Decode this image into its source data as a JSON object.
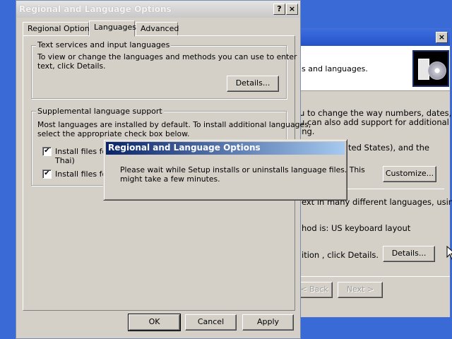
{
  "background_window": {
    "close_glyph": "×",
    "header_text": "s and languages.",
    "body_lines": [
      "u to change the way numbers, dates,",
      "u can also add support for additional",
      "ing."
    ],
    "locale_line": "ted States), and the",
    "customize_label": "Customize...",
    "text_line": "ext in many different languages, using",
    "method_line": "hod is: US keyboard layout",
    "details_line": "ition , click Details.",
    "details_label": "Details...",
    "back_label": "< Back",
    "next_label": "Next >"
  },
  "dialog": {
    "title": "Regional and Language Options",
    "help_glyph": "?",
    "close_glyph": "×",
    "tabs": [
      {
        "label": "Regional Options"
      },
      {
        "label": "Languages"
      },
      {
        "label": "Advanced"
      }
    ],
    "text_services": {
      "legend": "Text services and input languages",
      "line1": "To view or change the languages and methods you can use to enter",
      "line2": "text, click Details.",
      "details_label": "Details..."
    },
    "supplemental": {
      "legend": "Supplemental language support",
      "line1": "Most languages are installed by default. To install additional languages,",
      "line2": "select the appropriate check box below.",
      "checkbox1_line1": "Install files for c",
      "checkbox1_line2": "Thai)",
      "checkbox2_line1": "Install files for E",
      "checkbox1_checked": true,
      "checkbox2_checked": true,
      "check_glyph": "✔"
    },
    "ok_label": "OK",
    "cancel_label": "Cancel",
    "apply_label": "Apply"
  },
  "popup": {
    "title": "Regional and Language Options",
    "line1": "Please wait while Setup installs or uninstalls language files. This",
    "line2": "might take a few minutes."
  },
  "colors": {
    "desktop": "#3a6ad6",
    "dialog_face": "#d4d0c8",
    "popup_title_start": "#0a246a",
    "popup_title_end": "#a6caf0"
  }
}
